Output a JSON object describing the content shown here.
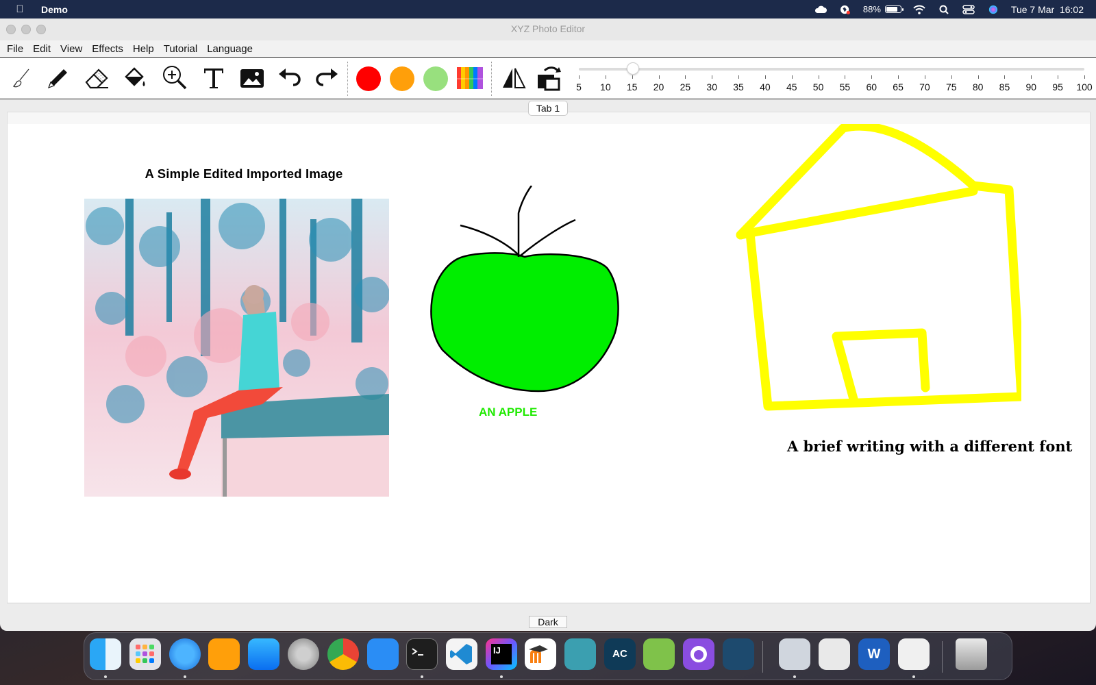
{
  "menubar": {
    "apple_icon": "apple-logo",
    "app_name": "Demo",
    "battery_percent": "88%",
    "battery_level": 0.88,
    "datetime": "Tue 7 Mar  16:02",
    "status_icons": [
      "icloud-icon",
      "vpn-icon",
      "battery-icon",
      "wifi-icon",
      "spotlight-icon",
      "control-center-icon",
      "siri-icon"
    ]
  },
  "window": {
    "title": "XYZ Photo Editor",
    "menu": [
      "File",
      "Edit",
      "View",
      "Effects",
      "Help",
      "Tutorial",
      "Language"
    ]
  },
  "toolbar": {
    "tools": [
      "brush-icon",
      "pencil-icon",
      "eraser-icon",
      "paint-bucket-icon",
      "zoom-in-icon",
      "text-icon",
      "image-icon",
      "undo-icon",
      "redo-icon"
    ],
    "colors": [
      "#ff0000",
      "#ff9f0a",
      "#98e07e",
      "palette"
    ],
    "transform_tools": [
      "flip-horizontal-icon",
      "rotate-icon"
    ],
    "slider": {
      "ticks": [
        "5",
        "10",
        "15",
        "20",
        "25",
        "30",
        "35",
        "40",
        "45",
        "50",
        "55",
        "60",
        "65",
        "70",
        "75",
        "80",
        "85",
        "90",
        "95",
        "100"
      ],
      "value": 15
    }
  },
  "tab": {
    "label": "Tab 1"
  },
  "canvas": {
    "heading": "A Simple Edited Imported Image",
    "apple_label": "AN APPLE",
    "apple_color": "#00ee00",
    "house_color": "#ffff00",
    "brief_text": "A brief writing with a different font"
  },
  "footer": {
    "theme_button": "Dark"
  },
  "dock": {
    "apps": [
      "finder-icon",
      "launchpad-icon",
      "safari-icon",
      "pages-icon",
      "app-store-icon",
      "system-settings-icon",
      "chrome-icon",
      "xcode-icon",
      "terminal-icon",
      "vscode-icon",
      "intellij-icon",
      "moodle-icon",
      "blender-icon",
      "ac-icon",
      "editor-icon",
      "github-icon",
      "mysql-icon",
      "preview-icon",
      "photos-icon",
      "word-icon",
      "java-icon",
      "trash-icon"
    ]
  }
}
